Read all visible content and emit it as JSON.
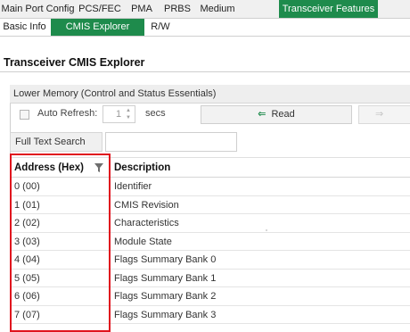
{
  "tabs": [
    {
      "label": "Main Port Config",
      "active": false
    },
    {
      "label": "PCS/FEC",
      "active": false
    },
    {
      "label": "PMA",
      "active": false
    },
    {
      "label": "PRBS",
      "active": false
    },
    {
      "label": "Medium",
      "active": false
    },
    {
      "label": "Transceiver Features",
      "active": true
    }
  ],
  "subtabs": [
    {
      "label": "Basic Info",
      "active": false
    },
    {
      "label": "CMIS Explorer",
      "active": true
    },
    {
      "label": "R/W",
      "active": false
    }
  ],
  "page_title": "Transceiver CMIS Explorer",
  "section": {
    "title": "Lower Memory (Control and Status Essentials)"
  },
  "toolbar": {
    "auto_refresh_label": "Auto Refresh:",
    "auto_refresh_checked": false,
    "interval_value": "1",
    "interval_unit": "secs",
    "read_label": "Read",
    "read_icon": "arrow-left-icon",
    "next_icon": "arrow-right-icon"
  },
  "search": {
    "label": "Full Text Search",
    "value": ""
  },
  "table": {
    "columns": [
      "Address (Hex)",
      "Description"
    ],
    "filter_icon": "filter-icon",
    "rows": [
      {
        "address": "0 (00)",
        "description": "Identifier"
      },
      {
        "address": "1 (01)",
        "description": "CMIS Revision"
      },
      {
        "address": "2 (02)",
        "description": "Characteristics"
      },
      {
        "address": "3 (03)",
        "description": "Module State"
      },
      {
        "address": "4 (04)",
        "description": "Flags Summary Bank 0"
      },
      {
        "address": "5 (05)",
        "description": "Flags Summary Bank 1"
      },
      {
        "address": "6 (06)",
        "description": "Flags Summary Bank 2"
      },
      {
        "address": "7 (07)",
        "description": "Flags Summary Bank 3"
      }
    ]
  },
  "colors": {
    "active_tab": "#1e8b4c",
    "highlight": "#e0141e"
  }
}
